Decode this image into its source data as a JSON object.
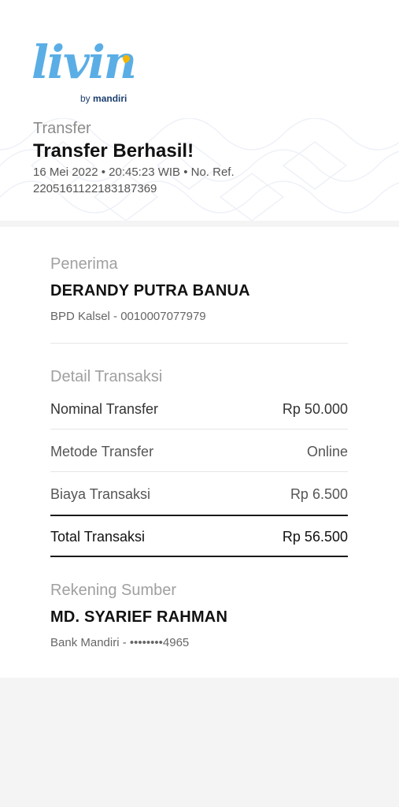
{
  "logo": {
    "script": "livin",
    "by": "by",
    "brand": "mandiri"
  },
  "header": {
    "label": "Transfer",
    "title": "Transfer Berhasil!",
    "datetime": "16 Mei 2022 • 20:45:23 WIB • No. Ref.",
    "reference": "2205161122183187369"
  },
  "recipient": {
    "section_title": "Penerima",
    "name": "DERANDY PUTRA BANUA",
    "account": "BPD Kalsel - 0010007077979"
  },
  "details": {
    "section_title": "Detail Transaksi",
    "rows": [
      {
        "label": "Nominal Transfer",
        "value": "Rp 50.000"
      },
      {
        "label": "Metode Transfer",
        "value": "Online"
      },
      {
        "label": "Biaya Transaksi",
        "value": "Rp 6.500"
      }
    ],
    "total": {
      "label": "Total Transaksi",
      "value": "Rp 56.500"
    }
  },
  "source": {
    "section_title": "Rekening Sumber",
    "name": "MD. SYARIEF RAHMAN",
    "account": "Bank Mandiri - ••••••••4965"
  },
  "colors": {
    "brand_blue": "#5aaee5",
    "brand_yellow": "#f4b400",
    "mandiri_navy": "#1c3e6e"
  }
}
